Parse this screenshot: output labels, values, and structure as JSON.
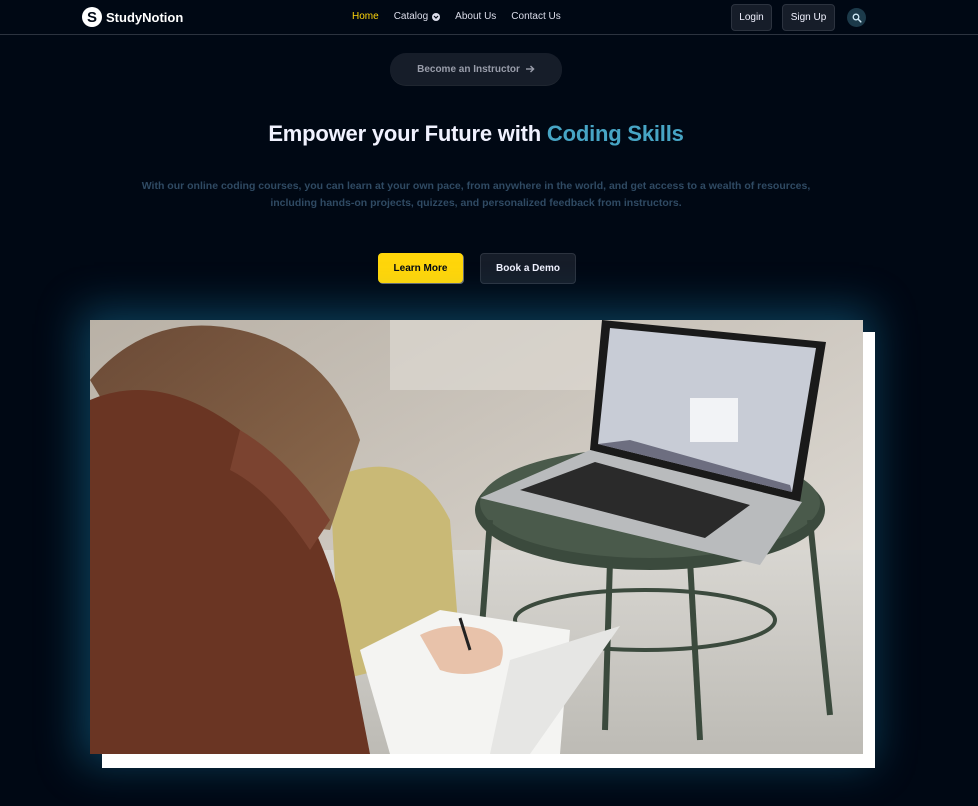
{
  "brand": {
    "name": "StudyNotion",
    "mark": "S"
  },
  "nav": {
    "links": [
      {
        "label": "Home",
        "active": true
      },
      {
        "label": "Catalog",
        "dropdown": true
      },
      {
        "label": "About Us"
      },
      {
        "label": "Contact Us"
      }
    ],
    "login_label": "Login",
    "signup_label": "Sign Up",
    "search_icon": "search-icon"
  },
  "hero": {
    "instructor_label": "Become an Instructor",
    "heading_prefix": "Empower your Future with ",
    "heading_highlight": "Coding Skills",
    "subtext": "With our online coding courses, you can learn at your own pace, from anywhere in the world, and get access to a wealth of resources, including hands-on projects, quizzes, and personalized feedback from instructors.",
    "learn_more_label": "Learn More",
    "book_demo_label": "Book a Demo"
  },
  "colors": {
    "background": "#000814",
    "accent_yellow": "#ffd60a",
    "highlight_blue": "#47a5c5",
    "card_dark": "#161d29",
    "muted_text": "#2f4a63"
  }
}
